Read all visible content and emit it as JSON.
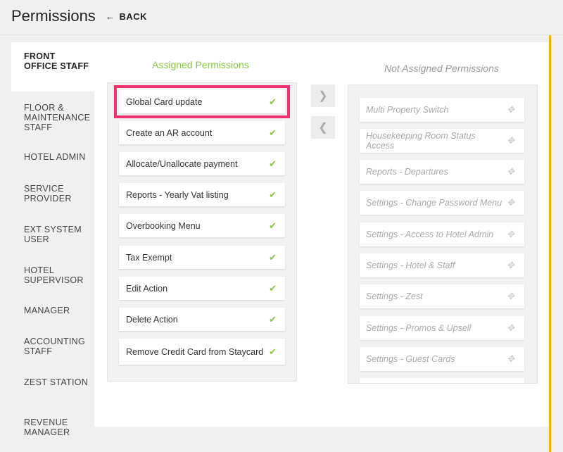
{
  "header": {
    "title": "Permissions",
    "back_label": "BACK"
  },
  "sidebar": {
    "items": [
      {
        "label": "FRONT OFFICE STAFF"
      },
      {
        "label": "FLOOR & MAINTENANCE STAFF"
      },
      {
        "label": "HOTEL ADMIN"
      },
      {
        "label": "SERVICE PROVIDER"
      },
      {
        "label": "EXT SYSTEM USER"
      },
      {
        "label": "HOTEL SUPERVISOR"
      },
      {
        "label": "MANAGER"
      },
      {
        "label": "ACCOUNTING STAFF"
      },
      {
        "label": "ZEST STATION"
      },
      {
        "label": "REVENUE MANAGER"
      }
    ],
    "active_index": 0
  },
  "assigned": {
    "title": "Assigned Permissions",
    "items": [
      {
        "label": "Global Card update",
        "highlighted": true
      },
      {
        "label": "Create an AR account"
      },
      {
        "label": "Allocate/Unallocate payment"
      },
      {
        "label": "Reports - Yearly Vat listing"
      },
      {
        "label": "Overbooking Menu"
      },
      {
        "label": "Tax Exempt"
      },
      {
        "label": "Edit Action"
      },
      {
        "label": "Delete Action"
      },
      {
        "label": "Remove Credit Card from Staycard"
      }
    ]
  },
  "not_assigned": {
    "title": "Not Assigned Permissions",
    "items": [
      {
        "label": "Multi Property Switch"
      },
      {
        "label": "Housekeeping Room Status Access"
      },
      {
        "label": "Reports - Departures"
      },
      {
        "label": "Settings - Change Password Menu"
      },
      {
        "label": "Settings - Access to Hotel Admin"
      },
      {
        "label": "Settings - Hotel & Staff"
      },
      {
        "label": "Settings - Zest"
      },
      {
        "label": "Settings - Promos & Upsell"
      },
      {
        "label": "Settings - Guest Cards"
      },
      {
        "label": ""
      }
    ]
  },
  "controls": {
    "move_right_icon": "chevron-right-icon",
    "move_left_icon": "chevron-left-icon",
    "check_icon": "check-icon",
    "drag_icon": "move-icon"
  },
  "colors": {
    "accent": "#f5b400",
    "assigned_title": "#8bc34a",
    "check": "#8bc34a",
    "highlight_outline": "#f0336f"
  }
}
